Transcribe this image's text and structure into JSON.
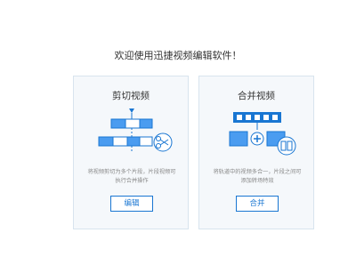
{
  "welcome_text": "欢迎使用迅捷视频编辑软件！",
  "cards": [
    {
      "title": "剪切视频",
      "description_line1": "将视频剪切为多个片段，片段视频可",
      "description_line2": "执行合并操作",
      "button_label": "编辑",
      "icon": "scissors-cut-icon"
    },
    {
      "title": "合并视频",
      "description_line1": "将轨道中的视频多合一，片段之间可",
      "description_line2": "添加转场特效",
      "button_label": "合并",
      "icon": "merge-video-icon"
    }
  ],
  "colors": {
    "accent": "#1976d2",
    "accent_light": "#4a9cf0",
    "card_bg": "#f5f8fb",
    "card_border": "#d8e4ee"
  }
}
